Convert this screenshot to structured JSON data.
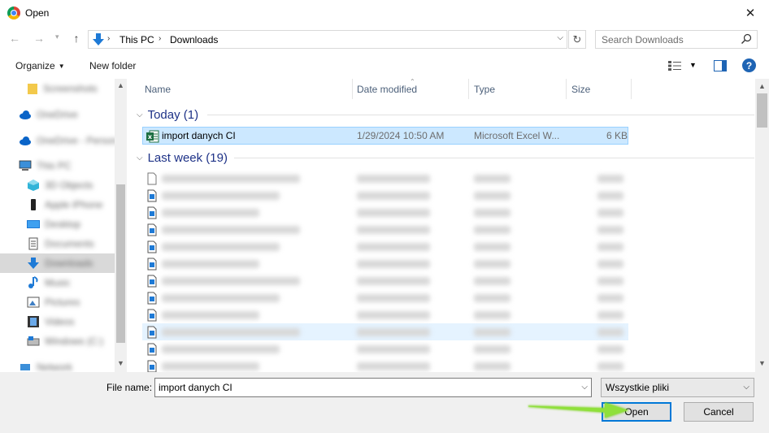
{
  "window": {
    "title": "Open"
  },
  "address": {
    "crumbs": [
      "This PC",
      "Downloads"
    ]
  },
  "search": {
    "placeholder": "Search Downloads"
  },
  "toolbar": {
    "organize": "Organize",
    "new_folder": "New folder",
    "help": "?"
  },
  "sidebar": {
    "items": [
      {
        "label": "Screenshots",
        "blurred": true,
        "icon": "folder-icon"
      },
      {
        "label": "OneDrive",
        "blurred": true,
        "icon": "cloud-icon"
      },
      {
        "label": "OneDrive - Personal",
        "blurred": true,
        "icon": "cloud-icon"
      },
      {
        "label": "This PC",
        "blurred": true,
        "icon": "computer-icon"
      },
      {
        "label": "3D Objects",
        "blurred": true,
        "icon": "cube-icon"
      },
      {
        "label": "Apple iPhone",
        "blurred": true,
        "icon": "phone-icon"
      },
      {
        "label": "Desktop",
        "blurred": true,
        "icon": "desktop-icon"
      },
      {
        "label": "Documents",
        "blurred": true,
        "icon": "document-icon"
      },
      {
        "label": "Downloads",
        "blurred": true,
        "icon": "download-icon",
        "selected": true
      },
      {
        "label": "Music",
        "blurred": true,
        "icon": "music-icon"
      },
      {
        "label": "Pictures",
        "blurred": true,
        "icon": "picture-icon"
      },
      {
        "label": "Videos",
        "blurred": true,
        "icon": "video-icon"
      },
      {
        "label": "Windows (C:)",
        "blurred": true,
        "icon": "drive-icon"
      },
      {
        "label": "Network",
        "blurred": true,
        "icon": "network-icon"
      }
    ]
  },
  "columns": {
    "name": "Name",
    "date": "Date modified",
    "type": "Type",
    "size": "Size"
  },
  "groups": {
    "today": {
      "label": "Today (1)"
    },
    "last_week": {
      "label": "Last week (19)"
    }
  },
  "selected_file": {
    "name": "import danych CI",
    "date": "1/29/2024 10:50 AM",
    "type": "Microsoft Excel W...",
    "size": "6 KB"
  },
  "bottom": {
    "file_name_label": "File name:",
    "file_name_value": "import danych CI",
    "file_type": "Wszystkie pliki",
    "open": "Open",
    "cancel": "Cancel"
  },
  "colors": {
    "accent": "#0078d7",
    "selection": "#cce8ff",
    "group": "#1e3287",
    "highlight_arrow": "#7ed321"
  }
}
